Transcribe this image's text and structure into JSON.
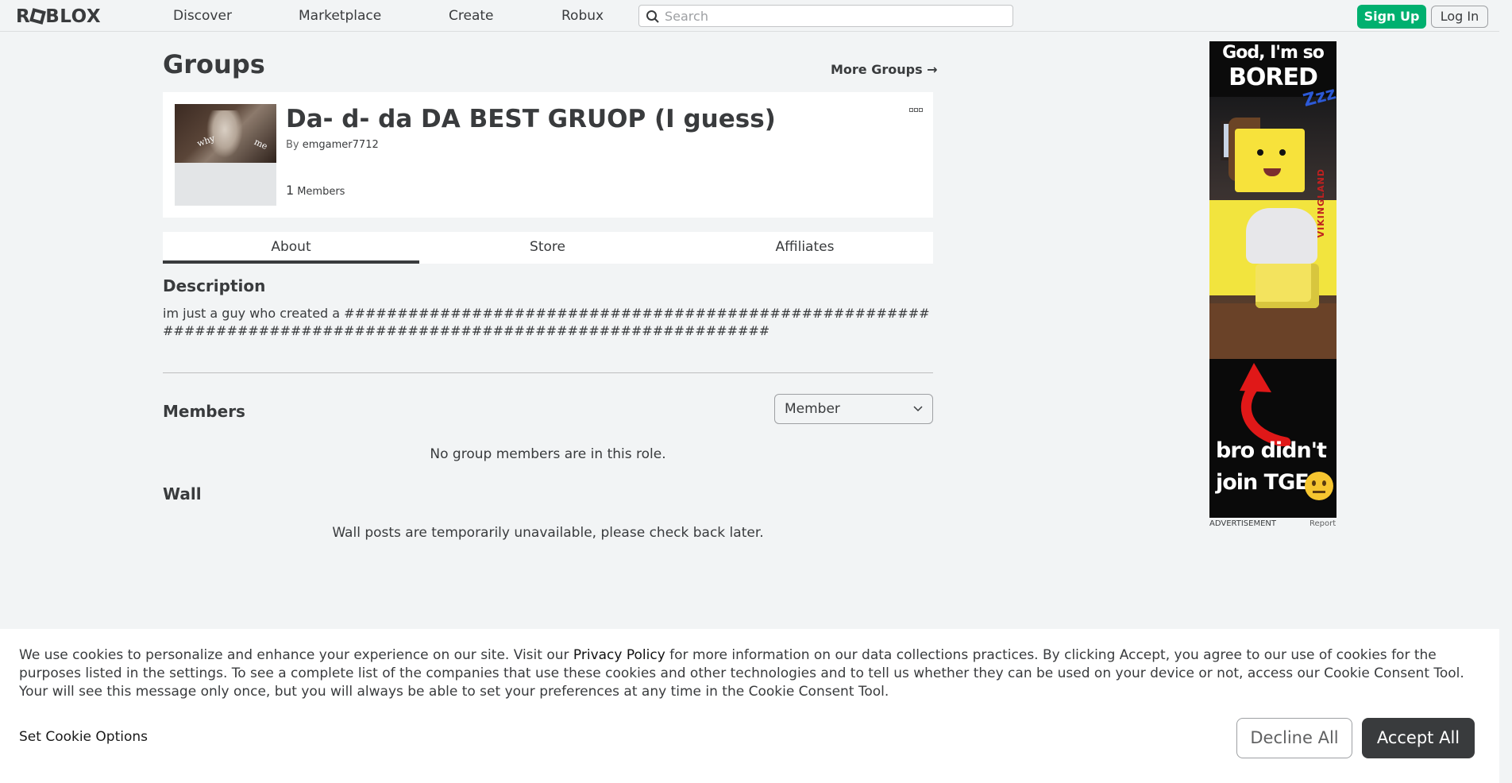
{
  "nav": {
    "logo": "ROBLOX",
    "links": [
      "Discover",
      "Marketplace",
      "Create",
      "Robux"
    ],
    "search_placeholder": "Search",
    "signup": "Sign Up",
    "login": "Log In"
  },
  "page": {
    "title": "Groups",
    "more_groups": "More Groups →"
  },
  "group": {
    "name": "Da- d- da DA BEST GRUOP (I guess)",
    "by_label": "By",
    "owner": "emgamer7712",
    "member_count": "1",
    "members_label": "Members",
    "thumb_word_1": "why",
    "thumb_word_2": "me",
    "more_icon": "more-options-icon"
  },
  "tabs": [
    "About",
    "Store",
    "Affiliates"
  ],
  "about": {
    "description_title": "Description",
    "description_text": "im just a guy who created a ################################################################################################################",
    "members_title": "Members",
    "role_selected": "Member",
    "members_empty": "No group members are in this role.",
    "wall_title": "Wall",
    "wall_msg": "Wall posts are temporarily unavailable, please check back later."
  },
  "ad": {
    "top_line_1": "God, I'm so",
    "top_line_2": "BORED",
    "side_text": "VIKINGLAND",
    "zzz": "Zzz",
    "bottom_line_1": "bro didn't",
    "bottom_line_2": "join TGE",
    "label": "ADVERTISEMENT",
    "report": "Report"
  },
  "cookie": {
    "text_before": "We use cookies to personalize and enhance your experience on our site. Visit our ",
    "privacy_link": "Privacy Policy",
    "text_after": " for more information on our data collections practices. By clicking Accept, you agree to our use of cookies for the purposes listed in the settings. To see a complete list of the companies that use these cookies and other technologies and to tell us whether they can be used on your device or not, access our Cookie Consent Tool. Your will see this message only once, but you will always be able to set your preferences at any time in the Cookie Consent Tool.",
    "set_options": "Set Cookie Options",
    "decline": "Decline All",
    "accept": "Accept All"
  },
  "colors": {
    "background": "#f2f4f5",
    "signup_green": "#00b06f",
    "text_dark": "#393b3d",
    "accept_bg": "#393b3d"
  }
}
